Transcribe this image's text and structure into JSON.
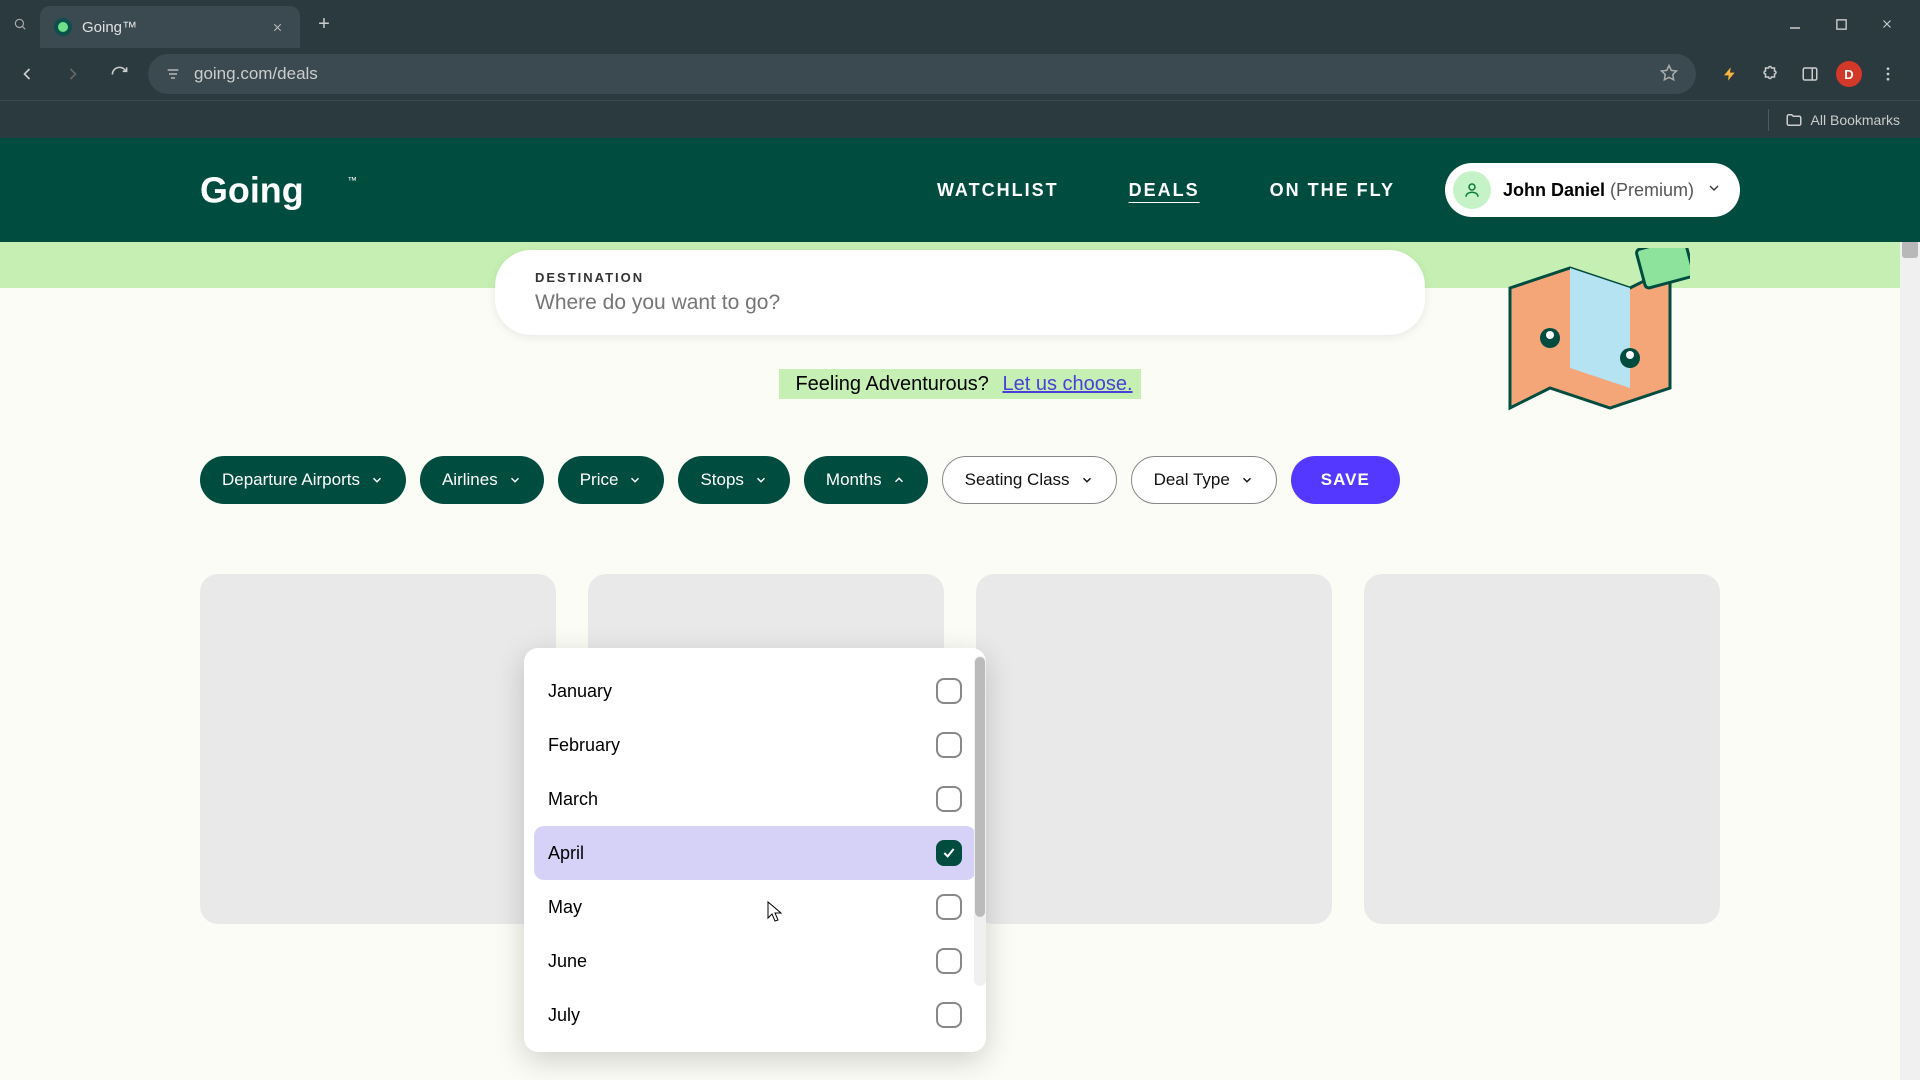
{
  "browser": {
    "tab_title": "Going™",
    "url": "going.com/deals",
    "bookmarks_label": "All Bookmarks",
    "profile_initial": "D"
  },
  "header": {
    "logo_text": "Going",
    "nav": {
      "watchlist": "WATCHLIST",
      "deals": "DEALS",
      "onthefly": "ON THE FLY"
    },
    "user_name": "John Daniel",
    "user_plan": "(Premium)"
  },
  "search": {
    "label": "DESTINATION",
    "placeholder": "Where do you want to go?"
  },
  "adventurous": {
    "prefix": "Feeling Adventurous? ",
    "link": "Let us choose."
  },
  "filters": {
    "departure": "Departure Airports",
    "airlines": "Airlines",
    "price": "Price",
    "stops": "Stops",
    "months": "Months",
    "seating": "Seating Class",
    "dealtype": "Deal Type",
    "save": "SAVE"
  },
  "months_dropdown": {
    "items": [
      {
        "label": "January",
        "checked": false
      },
      {
        "label": "February",
        "checked": false
      },
      {
        "label": "March",
        "checked": false
      },
      {
        "label": "April",
        "checked": true
      },
      {
        "label": "May",
        "checked": false
      },
      {
        "label": "June",
        "checked": false
      },
      {
        "label": "July",
        "checked": false
      }
    ]
  }
}
